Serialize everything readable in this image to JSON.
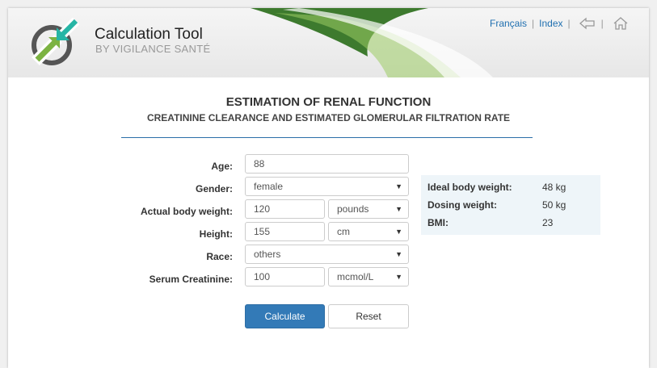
{
  "brand": {
    "title": "Calculation Tool",
    "subtitle": "BY VIGILANCE SANTÉ"
  },
  "nav": {
    "language": "Français",
    "index": "Index",
    "back_icon": "back-arrow-icon",
    "home_icon": "home-icon"
  },
  "page": {
    "title": "ESTIMATION OF RENAL FUNCTION",
    "subtitle": "CREATININE CLEARANCE AND ESTIMATED GLOMERULAR FILTRATION RATE"
  },
  "form": {
    "age": {
      "label": "Age:",
      "value": "88"
    },
    "gender": {
      "label": "Gender:",
      "value": "female"
    },
    "weight": {
      "label": "Actual body weight:",
      "value": "120",
      "unit": "pounds"
    },
    "height": {
      "label": "Height:",
      "value": "155",
      "unit": "cm"
    },
    "race": {
      "label": "Race:",
      "value": "others"
    },
    "creatinine": {
      "label": "Serum Creatinine:",
      "value": "100",
      "unit": "mcmol/L"
    }
  },
  "results": [
    {
      "label": "Ideal body weight:",
      "value": "48 kg"
    },
    {
      "label": "Dosing weight:",
      "value": "50 kg"
    },
    {
      "label": "BMI:",
      "value": "23"
    }
  ],
  "buttons": {
    "calculate": "Calculate",
    "reset": "Reset"
  },
  "colors": {
    "accent": "#337ab7",
    "link": "#1f6fb0",
    "logo_green": "#7cb342",
    "logo_teal": "#26b5a5"
  }
}
